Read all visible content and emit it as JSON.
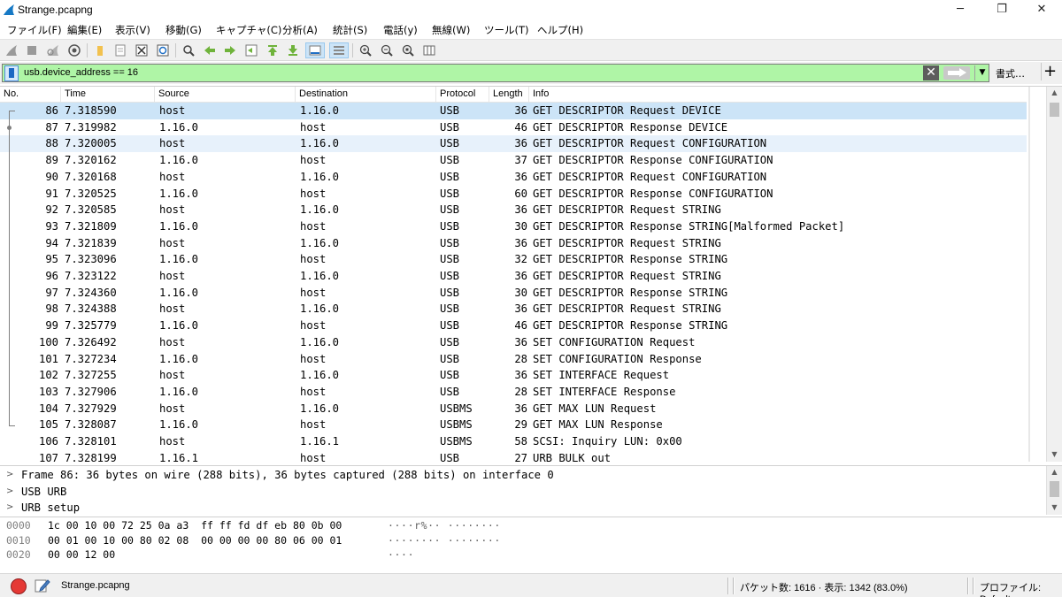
{
  "window": {
    "title": "Strange.pcapng",
    "minimize_glyph": "─",
    "maximize_glyph": "❐",
    "close_glyph": "✕"
  },
  "menu": [
    "ファイル(F)",
    "編集(E)",
    "表示(V)",
    "移動(G)",
    "キャプチャ(C)",
    "分析(A)",
    "統計(S)",
    "電話(y)",
    "無線(W)",
    "ツール(T)",
    "ヘルプ(H)"
  ],
  "toolbar_icons": [
    "start-capture-icon",
    "stop-capture-icon",
    "restart-capture-icon",
    "capture-options-icon",
    "open-file-icon",
    "save-file-icon",
    "close-file-icon",
    "reload-file-icon",
    "find-packet-icon",
    "go-back-icon",
    "go-forward-icon",
    "go-to-packet-icon",
    "go-first-icon",
    "go-last-icon",
    "auto-scroll-icon",
    "colorize-icon",
    "zoom-in-icon",
    "zoom-out-icon",
    "zoom-normal-icon",
    "resize-columns-icon"
  ],
  "filter": {
    "value": "usb.device_address == 16",
    "clear_glyph": "✕",
    "dropdown_glyph": "▼",
    "expression_label": "書式…",
    "add_glyph": "+",
    "bg_color": "#aff5a6"
  },
  "columns": [
    "No.",
    "Time",
    "Source",
    "Destination",
    "Protocol",
    "Length",
    "Info"
  ],
  "packets": [
    {
      "no": "86",
      "time": "7.318590",
      "source": "host",
      "destination": "1.16.0",
      "protocol": "USB",
      "length": "36",
      "info": "GET DESCRIPTOR Request DEVICE"
    },
    {
      "no": "87",
      "time": "7.319982",
      "source": "1.16.0",
      "destination": "host",
      "protocol": "USB",
      "length": "46",
      "info": "GET DESCRIPTOR Response DEVICE"
    },
    {
      "no": "88",
      "time": "7.320005",
      "source": "host",
      "destination": "1.16.0",
      "protocol": "USB",
      "length": "36",
      "info": "GET DESCRIPTOR Request CONFIGURATION"
    },
    {
      "no": "89",
      "time": "7.320162",
      "source": "1.16.0",
      "destination": "host",
      "protocol": "USB",
      "length": "37",
      "info": "GET DESCRIPTOR Response CONFIGURATION"
    },
    {
      "no": "90",
      "time": "7.320168",
      "source": "host",
      "destination": "1.16.0",
      "protocol": "USB",
      "length": "36",
      "info": "GET DESCRIPTOR Request CONFIGURATION"
    },
    {
      "no": "91",
      "time": "7.320525",
      "source": "1.16.0",
      "destination": "host",
      "protocol": "USB",
      "length": "60",
      "info": "GET DESCRIPTOR Response CONFIGURATION"
    },
    {
      "no": "92",
      "time": "7.320585",
      "source": "host",
      "destination": "1.16.0",
      "protocol": "USB",
      "length": "36",
      "info": "GET DESCRIPTOR Request STRING"
    },
    {
      "no": "93",
      "time": "7.321809",
      "source": "1.16.0",
      "destination": "host",
      "protocol": "USB",
      "length": "30",
      "info": "GET DESCRIPTOR Response STRING[Malformed Packet]"
    },
    {
      "no": "94",
      "time": "7.321839",
      "source": "host",
      "destination": "1.16.0",
      "protocol": "USB",
      "length": "36",
      "info": "GET DESCRIPTOR Request STRING"
    },
    {
      "no": "95",
      "time": "7.323096",
      "source": "1.16.0",
      "destination": "host",
      "protocol": "USB",
      "length": "32",
      "info": "GET DESCRIPTOR Response STRING"
    },
    {
      "no": "96",
      "time": "7.323122",
      "source": "host",
      "destination": "1.16.0",
      "protocol": "USB",
      "length": "36",
      "info": "GET DESCRIPTOR Request STRING"
    },
    {
      "no": "97",
      "time": "7.324360",
      "source": "1.16.0",
      "destination": "host",
      "protocol": "USB",
      "length": "30",
      "info": "GET DESCRIPTOR Response STRING"
    },
    {
      "no": "98",
      "time": "7.324388",
      "source": "host",
      "destination": "1.16.0",
      "protocol": "USB",
      "length": "36",
      "info": "GET DESCRIPTOR Request STRING"
    },
    {
      "no": "99",
      "time": "7.325779",
      "source": "1.16.0",
      "destination": "host",
      "protocol": "USB",
      "length": "46",
      "info": "GET DESCRIPTOR Response STRING"
    },
    {
      "no": "100",
      "time": "7.326492",
      "source": "host",
      "destination": "1.16.0",
      "protocol": "USB",
      "length": "36",
      "info": "SET CONFIGURATION Request"
    },
    {
      "no": "101",
      "time": "7.327234",
      "source": "1.16.0",
      "destination": "host",
      "protocol": "USB",
      "length": "28",
      "info": "SET CONFIGURATION Response"
    },
    {
      "no": "102",
      "time": "7.327255",
      "source": "host",
      "destination": "1.16.0",
      "protocol": "USB",
      "length": "36",
      "info": "SET INTERFACE Request"
    },
    {
      "no": "103",
      "time": "7.327906",
      "source": "1.16.0",
      "destination": "host",
      "protocol": "USB",
      "length": "28",
      "info": "SET INTERFACE Response"
    },
    {
      "no": "104",
      "time": "7.327929",
      "source": "host",
      "destination": "1.16.0",
      "protocol": "USBMS",
      "length": "36",
      "info": "GET MAX LUN Request"
    },
    {
      "no": "105",
      "time": "7.328087",
      "source": "1.16.0",
      "destination": "host",
      "protocol": "USBMS",
      "length": "29",
      "info": "GET MAX LUN Response"
    },
    {
      "no": "106",
      "time": "7.328101",
      "source": "host",
      "destination": "1.16.1",
      "protocol": "USBMS",
      "length": "58",
      "info": "SCSI: Inquiry LUN: 0x00"
    },
    {
      "no": "107",
      "time": "7.328199",
      "source": "1.16.1",
      "destination": "host",
      "protocol": "USB",
      "length": "27",
      "info": "URB_BULK out"
    }
  ],
  "selected_packet": "86",
  "related_packet": "88",
  "details": [
    {
      "chevron": ">",
      "text": "Frame 86: 36 bytes on wire (288 bits), 36 bytes captured (288 bits) on interface 0"
    },
    {
      "chevron": ">",
      "text": "USB URB"
    },
    {
      "chevron": ">",
      "text": "URB setup"
    }
  ],
  "bytes": [
    {
      "offset": "0000",
      "hex": "1c 00 10 00 72 25 0a a3  ff ff fd df eb 80 0b 00",
      "ascii": "····r%·· ········"
    },
    {
      "offset": "0010",
      "hex": "00 01 00 10 00 80 02 08  00 00 00 00 80 06 00 01",
      "ascii": "········ ········"
    },
    {
      "offset": "0020",
      "hex": "00 00 12 00",
      "ascii": "····"
    }
  ],
  "scroll_glyphs": {
    "up": "▲",
    "down": "▼"
  },
  "status": {
    "file": "Strange.pcapng",
    "packets": "パケット数: 1616 · 表示: 1342 (83.0%)",
    "profile": "プロファイル: Default"
  },
  "colors": {
    "selected_row": "#cce4f7",
    "related_row": "#e7f1fb",
    "filter_valid": "#aff5a6"
  }
}
